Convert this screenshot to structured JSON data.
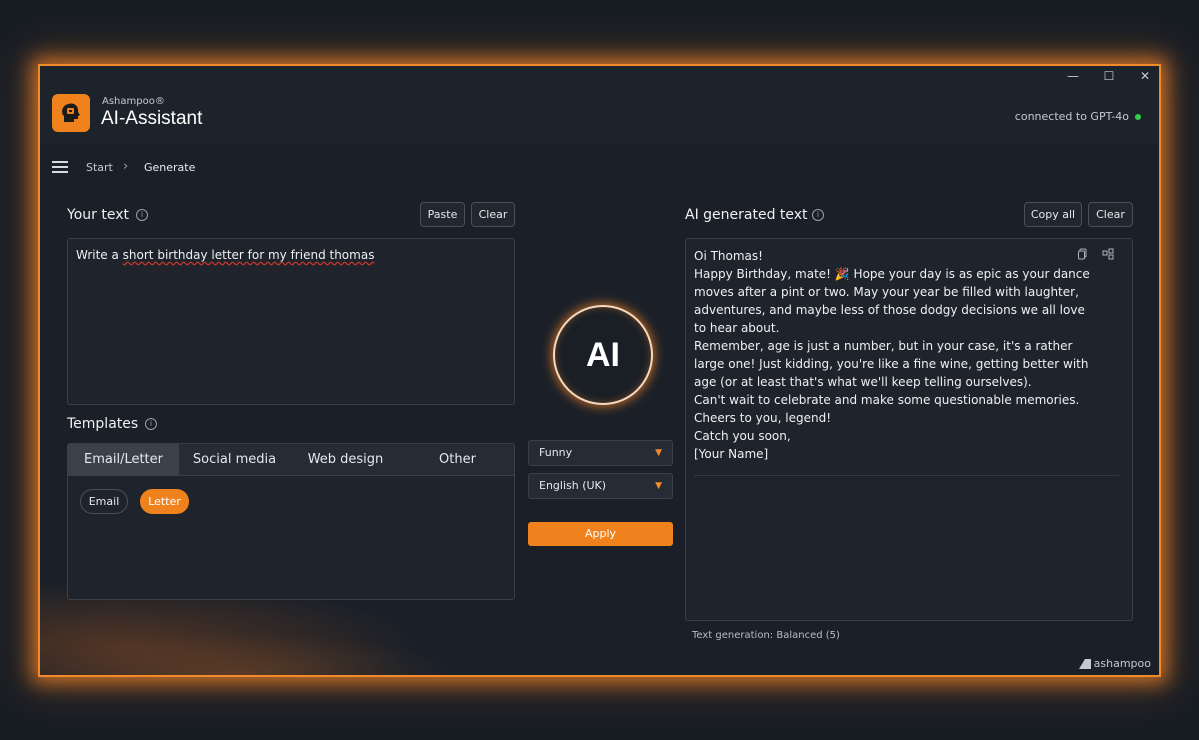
{
  "window": {
    "minimize": "—",
    "maximize": "☐",
    "close": "✕"
  },
  "header": {
    "brand_small": "Ashampoo®",
    "brand_big": "AI-Assistant",
    "connection_status": "connected to GPT-4o"
  },
  "breadcrumb": {
    "start": "Start",
    "current": "Generate"
  },
  "your_text": {
    "title": "Your text",
    "paste": "Paste",
    "clear": "Clear",
    "input_prefix": "Write a ",
    "input_misspelled": "short birthday letter for my friend thomas"
  },
  "templates": {
    "title": "Templates",
    "tabs": [
      "Email/Letter",
      "Social media",
      "Web design",
      "Other"
    ],
    "active_tab": "Email/Letter",
    "chips": [
      "Email",
      "Letter"
    ],
    "active_chip": "Letter"
  },
  "center": {
    "ai_label": "AI",
    "tone": "Funny",
    "language": "English (UK)",
    "apply": "Apply"
  },
  "ai_generated": {
    "title": "AI generated text",
    "copy_all": "Copy all",
    "clear": "Clear",
    "lines": [
      "Oi Thomas!",
      "Happy Birthday, mate! 🎉  Hope your day is as epic as your dance",
      "moves after a pint or two. May your year be filled with laughter,",
      "adventures, and maybe less of those dodgy decisions we all love",
      "to hear about.",
      "Remember, age is just a number, but in your case, it's a rather",
      "large one! Just kidding, you're like a fine wine, getting better with",
      "age (or at least that's what we'll keep telling ourselves).",
      "Can't wait to celebrate and make some questionable memories.",
      "Cheers to you, legend!",
      "Catch you soon,",
      "[Your Name]"
    ],
    "status": "Text generation:  Balanced (5)"
  },
  "footer": {
    "logo": "ashampoo"
  },
  "colors": {
    "accent": "#f0821e",
    "connected": "#2fd14a"
  }
}
